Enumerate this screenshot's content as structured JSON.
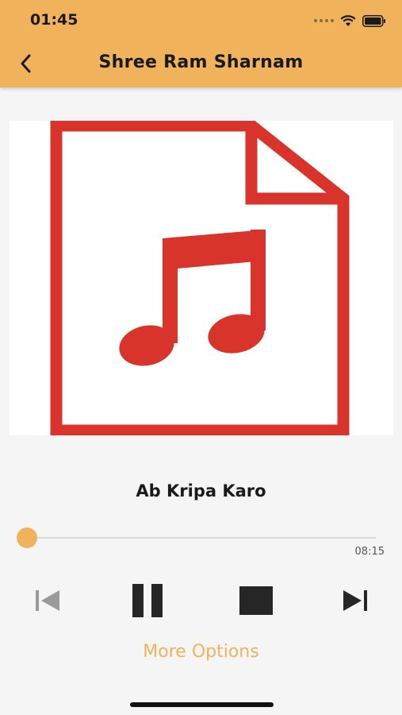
{
  "status_bar": {
    "time": "01:45"
  },
  "header": {
    "title": "Shree Ram Sharnam",
    "back_icon": "chevron-left-icon"
  },
  "artwork": {
    "icon": "music-file-icon",
    "color": "#d9342b"
  },
  "player": {
    "track_title": "Ab Kripa Karo",
    "duration": "08:15",
    "progress": 0.0
  },
  "controls": {
    "previous_icon": "skip-previous-icon",
    "pause_icon": "pause-icon",
    "stop_icon": "stop-icon",
    "next_icon": "skip-next-icon"
  },
  "more_options_label": "More Options",
  "colors": {
    "accent": "#f0b35c",
    "text": "#1a1a1a",
    "icon_dark": "#262626",
    "icon_disabled": "#9a9a9a"
  }
}
